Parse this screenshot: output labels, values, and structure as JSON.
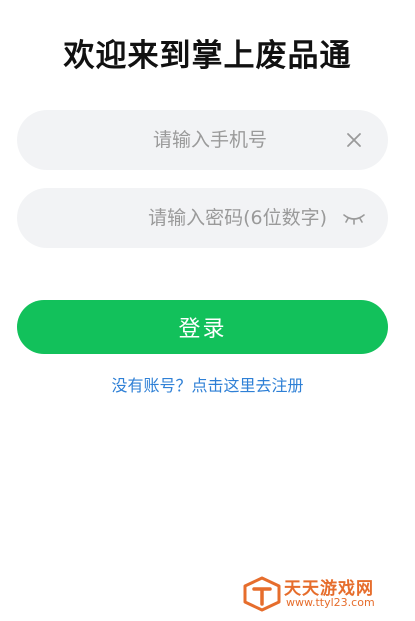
{
  "header": {
    "title": "欢迎来到掌上废品通"
  },
  "form": {
    "phone": {
      "placeholder": "请输入手机号",
      "value": "",
      "clear_icon": "close-icon"
    },
    "password": {
      "placeholder": "请输入密码(6位数字)",
      "value": "",
      "toggle_icon": "eye-closed-icon"
    },
    "login_label": "登录",
    "register_link": "没有账号？点击这里去注册"
  },
  "watermark": {
    "brand": "天天游戏网",
    "url": "www.ttyl23.com"
  },
  "colors": {
    "primary": "#12c15b",
    "link": "#2f80d6",
    "field_bg": "#f2f3f5",
    "watermark": "#e66d2c"
  }
}
